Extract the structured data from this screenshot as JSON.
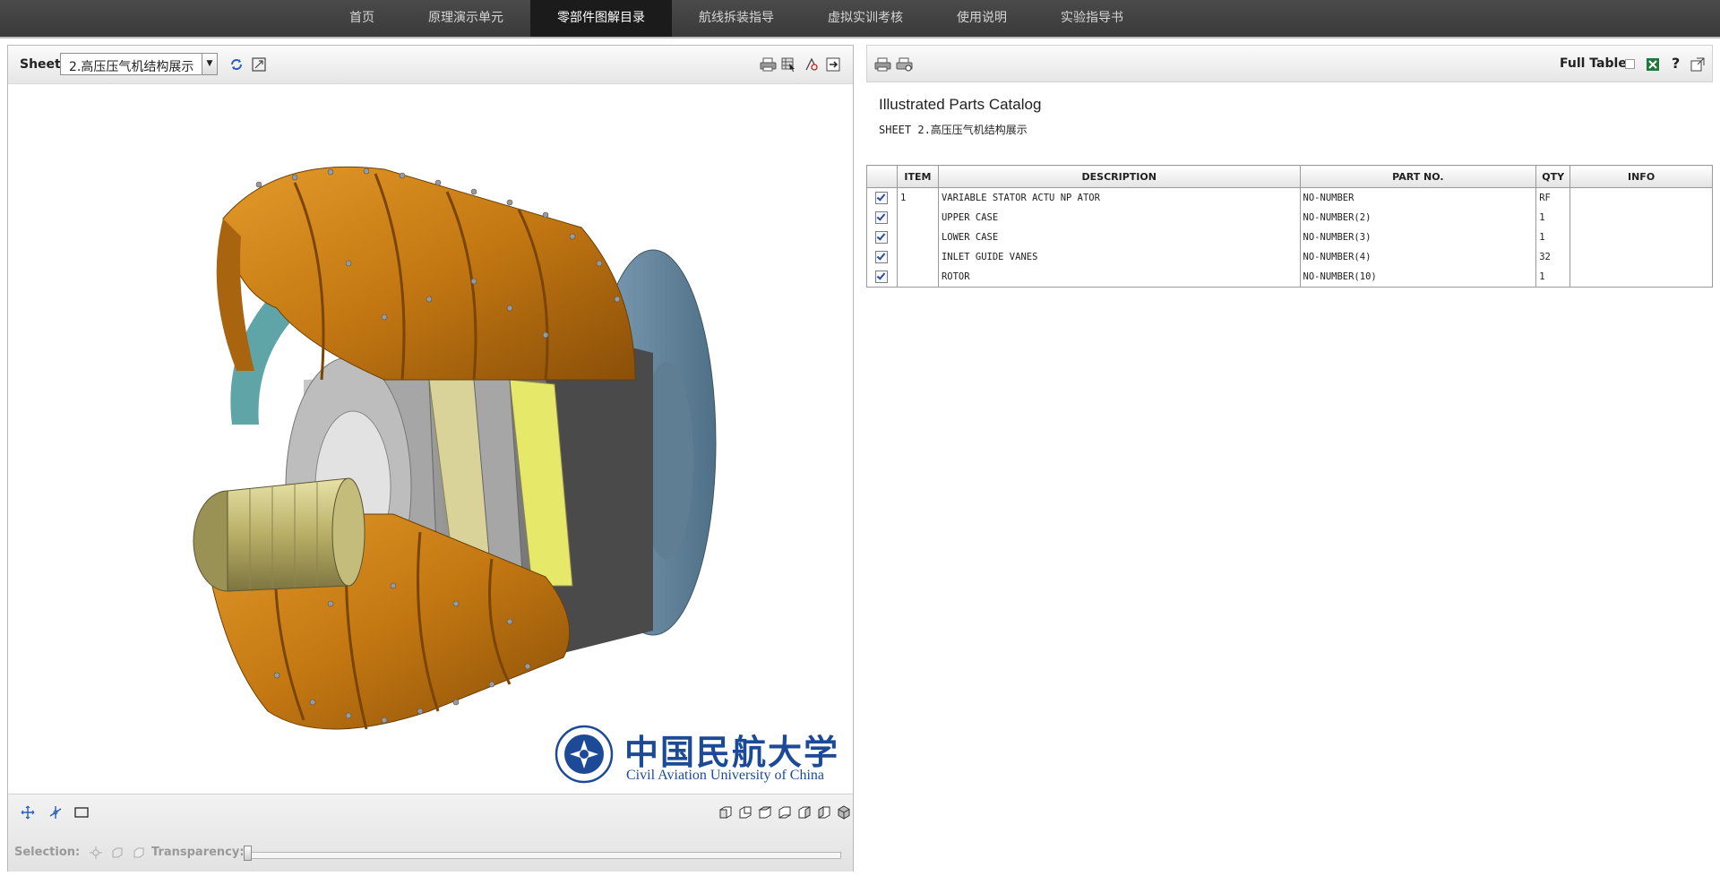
{
  "nav": {
    "items": [
      {
        "label": "首页"
      },
      {
        "label": "原理演示单元"
      },
      {
        "label": "零部件图解目录"
      },
      {
        "label": "航线拆装指导"
      },
      {
        "label": "虚拟实训考核"
      },
      {
        "label": "使用说明"
      },
      {
        "label": "实验指导书"
      }
    ],
    "active_index": 2
  },
  "viewer": {
    "sheet_label": "Sheet",
    "sheet_value": "2.高压压气机结构展示",
    "icons": [
      "refresh-icon",
      "fit-view-icon",
      "print-icon",
      "select-table-icon",
      "measure-icon",
      "exit-icon"
    ],
    "selection_label": "Selection:",
    "transparency_label": "Transparency:",
    "transparency_level": 0,
    "logo": {
      "cn": "中国民航大学",
      "en": "Civil Aviation University of China"
    }
  },
  "catalog": {
    "full_table_label": "Full Table",
    "help_label": "?",
    "title": "Illustrated Parts Catalog",
    "sheet_line": "SHEET 2.高压压气机结构展示",
    "columns": [
      "ITEM",
      "DESCRIPTION",
      "PART NO.",
      "QTY",
      "INFO"
    ],
    "rows": [
      {
        "item": "1",
        "description": "VARIABLE STATOR ACTU NP  ATOR",
        "part_no": "NO-NUMBER",
        "qty": "RF",
        "info": ""
      },
      {
        "item": "",
        "description": "UPPER CASE",
        "part_no": "NO-NUMBER(2)",
        "qty": "1",
        "info": ""
      },
      {
        "item": "",
        "description": "LOWER CASE",
        "part_no": "NO-NUMBER(3)",
        "qty": "1",
        "info": ""
      },
      {
        "item": "",
        "description": "INLET GUIDE VANES",
        "part_no": "NO-NUMBER(4)",
        "qty": "32",
        "info": ""
      },
      {
        "item": "",
        "description": "ROTOR",
        "part_no": "NO-NUMBER(10)",
        "qty": "1",
        "info": ""
      }
    ]
  },
  "colors": {
    "nav_bg": "#3e3e3e",
    "nav_active": "#1b1b1b",
    "case_orange": "#c77a12",
    "logo_blue": "#1d4a96"
  }
}
